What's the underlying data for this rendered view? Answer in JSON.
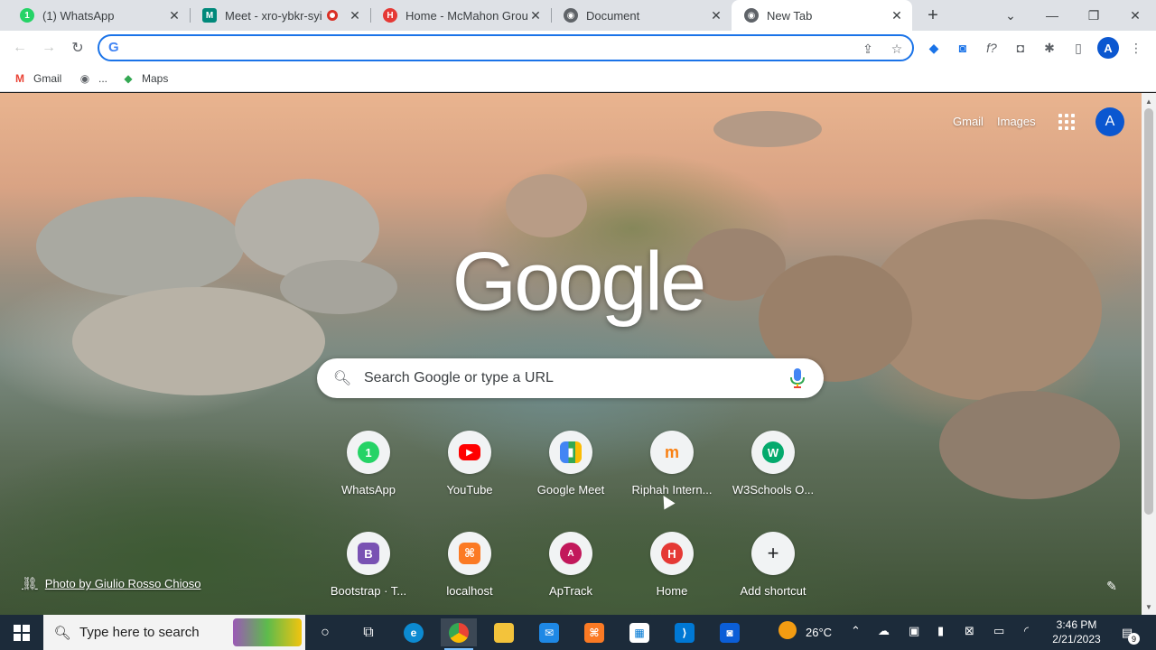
{
  "tabs": [
    {
      "title": "(1) WhatsApp",
      "favicon": "whatsapp-icon",
      "color": "#25d366",
      "glyph": "1"
    },
    {
      "title": "Meet - xro-ybkr-syi",
      "favicon": "meet-icon",
      "color": "#00897b",
      "glyph": "M"
    },
    {
      "title": "Home - McMahon Group",
      "favicon": "mcmahon-icon",
      "color": "#e53935",
      "glyph": "H"
    },
    {
      "title": "Document",
      "favicon": "globe-icon",
      "color": "#5f6368",
      "glyph": "●"
    },
    {
      "title": "New Tab",
      "favicon": "chrome-icon",
      "color": "#5f6368",
      "glyph": "◉",
      "active": true
    }
  ],
  "window": {
    "minimize": "—",
    "restore": "❐",
    "close": "✕",
    "new_tab": "+",
    "tab_search": "⌄"
  },
  "toolbar": {
    "back": "←",
    "forward": "→",
    "reload": "↻",
    "omnibox_value": "",
    "omnibox_placeholder": ""
  },
  "profile_initial": "A",
  "bookmarks": [
    {
      "label": "Gmail",
      "icon": "gmail-icon",
      "glyph": "M",
      "color": "#ea4335"
    },
    {
      "label": "...",
      "icon": "globe-icon",
      "glyph": "◉",
      "color": "#5f6368"
    },
    {
      "label": "Maps",
      "icon": "maps-icon",
      "glyph": "◆",
      "color": "#34a853"
    }
  ],
  "header": {
    "gmail": "Gmail",
    "images": "Images",
    "avatar": "A"
  },
  "logo": "Google",
  "search": {
    "placeholder": "Search Google or type a URL"
  },
  "shortcuts": [
    {
      "label": "WhatsApp",
      "icon": "whatsapp-icon",
      "color": "#25d366",
      "glyph": "1"
    },
    {
      "label": "YouTube",
      "icon": "youtube-icon",
      "color": "#ff0000",
      "glyph": "▶"
    },
    {
      "label": "Google Meet",
      "icon": "meet-icon",
      "color": "#00897b",
      "glyph": "▮"
    },
    {
      "label": "Riphah Intern...",
      "icon": "moodle-icon",
      "color": "#f98012",
      "glyph": "m"
    },
    {
      "label": "W3Schools O...",
      "icon": "w3schools-icon",
      "color": "#04aa6d",
      "glyph": "W"
    },
    {
      "label": "Bootstrap · T...",
      "icon": "bootstrap-icon",
      "color": "#7952b3",
      "glyph": "B"
    },
    {
      "label": "localhost",
      "icon": "xampp-icon",
      "color": "#fb7a24",
      "glyph": "⌘"
    },
    {
      "label": "ApTrack",
      "icon": "aptrack-icon",
      "color": "#c2185b",
      "glyph": "A"
    },
    {
      "label": "Home",
      "icon": "mcmahon-icon",
      "color": "#e53935",
      "glyph": "H"
    },
    {
      "label": "Add shortcut",
      "icon": "plus-icon",
      "color": "#f1f3f4",
      "glyph": "+"
    }
  ],
  "photo_credit": "Photo by Giulio Rosso Chioso",
  "taskbar": {
    "search_placeholder": "Type here to search",
    "weather": "26°C",
    "time": "3:46 PM",
    "date": "2/21/2023",
    "notification_count": "9"
  }
}
